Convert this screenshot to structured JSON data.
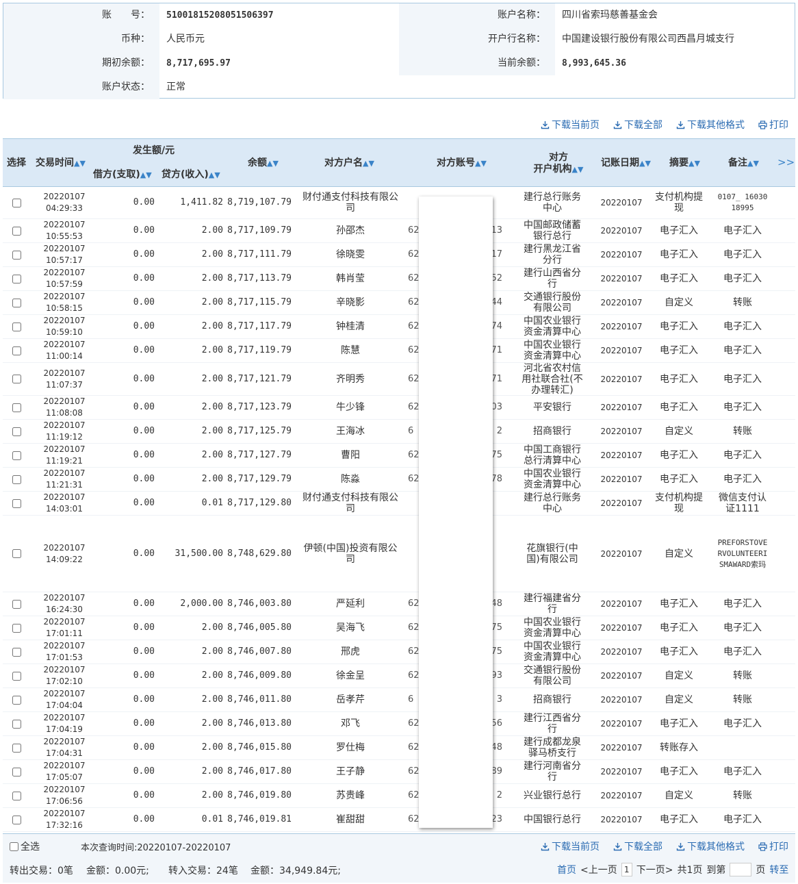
{
  "account_info": {
    "account_no_label": "账　　号：",
    "account_no": "51001815208051506397",
    "account_name_label": "账户名称：",
    "account_name": "四川省索玛慈善基金会",
    "currency_label": "币种：",
    "currency": "人民币元",
    "bank_label": "开户行名称：",
    "bank": "中国建设银行股份有限公司西昌月城支行",
    "opening_balance_label": "期初余额：",
    "opening_balance": "8,717,695.97",
    "current_balance_label": "当前余额：",
    "current_balance": "8,993,645.36",
    "status_label": "账户状态：",
    "status": "正常"
  },
  "toolbar": {
    "download_page": "下载当前页",
    "download_all": "下载全部",
    "download_other": "下载其他格式",
    "print": "打印"
  },
  "table_header": {
    "select": "选择",
    "time": "交易时间",
    "amount_group": "发生额/元",
    "debit": "借方(支取)",
    "credit": "贷方(收入)",
    "balance": "余额",
    "counterparty_name": "对方户名",
    "counterparty_account": "对方账号",
    "counterparty_org_1": "对方",
    "counterparty_org_2": "开户机构",
    "post_date": "记账日期",
    "summary": "摘要",
    "note": "备注",
    "more": ">>"
  },
  "rows": [
    {
      "date": "20220107",
      "time": "04:29:33",
      "debit": "0.00",
      "credit": "1,411.82",
      "balance": "8,719,107.79",
      "name": "财付通支付科技有限公司",
      "acct_pre": "",
      "acct_suf": "",
      "org": "建行总行账务中心",
      "post": "20220107",
      "summary": "支付机构提现",
      "note": "0107_ 16030 18995"
    },
    {
      "date": "20220107",
      "time": "10:55:53",
      "debit": "0.00",
      "credit": "2.00",
      "balance": "8,717,109.79",
      "name": "孙邵杰",
      "acct_pre": "62",
      "acct_suf": "13",
      "org": "中国邮政储蓄银行总行",
      "post": "20220107",
      "summary": "电子汇入",
      "note": "电子汇入"
    },
    {
      "date": "20220107",
      "time": "10:57:17",
      "debit": "0.00",
      "credit": "2.00",
      "balance": "8,717,111.79",
      "name": "徐晓雯",
      "acct_pre": "62",
      "acct_suf": "17",
      "org": "建行黑龙江省分行",
      "post": "20220107",
      "summary": "电子汇入",
      "note": "电子汇入"
    },
    {
      "date": "20220107",
      "time": "10:57:59",
      "debit": "0.00",
      "credit": "2.00",
      "balance": "8,717,113.79",
      "name": "韩肖莹",
      "acct_pre": "62",
      "acct_suf": "52",
      "org": "建行山西省分行",
      "post": "20220107",
      "summary": "电子汇入",
      "note": "电子汇入"
    },
    {
      "date": "20220107",
      "time": "10:58:15",
      "debit": "0.00",
      "credit": "2.00",
      "balance": "8,717,115.79",
      "name": "辛晓影",
      "acct_pre": "62",
      "acct_suf": "44",
      "org": "交通银行股份有限公司",
      "post": "20220107",
      "summary": "自定义",
      "note": "转账"
    },
    {
      "date": "20220107",
      "time": "10:59:10",
      "debit": "0.00",
      "credit": "2.00",
      "balance": "8,717,117.79",
      "name": "钟桂清",
      "acct_pre": "62",
      "acct_suf": "74",
      "org": "中国农业银行资金清算中心",
      "post": "20220107",
      "summary": "电子汇入",
      "note": "电子汇入"
    },
    {
      "date": "20220107",
      "time": "11:00:14",
      "debit": "0.00",
      "credit": "2.00",
      "balance": "8,717,119.79",
      "name": "陈慧",
      "acct_pre": "62",
      "acct_suf": "71",
      "org": "中国农业银行资金清算中心",
      "post": "20220107",
      "summary": "电子汇入",
      "note": "电子汇入"
    },
    {
      "date": "20220107",
      "time": "11:07:37",
      "debit": "0.00",
      "credit": "2.00",
      "balance": "8,717,121.79",
      "name": "齐明秀",
      "acct_pre": "62",
      "acct_suf": "71",
      "org": "河北省农村信用社联合社(不办理转汇)",
      "post": "20220107",
      "summary": "电子汇入",
      "note": "电子汇入"
    },
    {
      "date": "20220107",
      "time": "11:08:08",
      "debit": "0.00",
      "credit": "2.00",
      "balance": "8,717,123.79",
      "name": "牛少锋",
      "acct_pre": "62",
      "acct_suf": "03",
      "org": "平安银行",
      "post": "20220107",
      "summary": "电子汇入",
      "note": "电子汇入"
    },
    {
      "date": "20220107",
      "time": "11:19:12",
      "debit": "0.00",
      "credit": "2.00",
      "balance": "8,717,125.79",
      "name": "王海冰",
      "acct_pre": "6",
      "acct_suf": "2",
      "org": "招商银行",
      "post": "20220107",
      "summary": "自定义",
      "note": "转账"
    },
    {
      "date": "20220107",
      "time": "11:19:21",
      "debit": "0.00",
      "credit": "2.00",
      "balance": "8,717,127.79",
      "name": "曹阳",
      "acct_pre": "62",
      "acct_suf": "75",
      "org": "中国工商银行总行清算中心",
      "post": "20220107",
      "summary": "电子汇入",
      "note": "电子汇入"
    },
    {
      "date": "20220107",
      "time": "11:21:31",
      "debit": "0.00",
      "credit": "2.00",
      "balance": "8,717,129.79",
      "name": "陈淼",
      "acct_pre": "62",
      "acct_suf": "78",
      "org": "中国农业银行资金清算中心",
      "post": "20220107",
      "summary": "电子汇入",
      "note": "电子汇入"
    },
    {
      "date": "20220107",
      "time": "14:03:01",
      "debit": "0.00",
      "credit": "0.01",
      "balance": "8,717,129.80",
      "name": "财付通支付科技有限公司",
      "acct_pre": "",
      "acct_suf": "",
      "org": "建行总行账务中心",
      "post": "20220107",
      "summary": "支付机构提现",
      "note": "微信支付认证1111"
    },
    {
      "date": "20220107",
      "time": "14:09:22",
      "debit": "0.00",
      "credit": "31,500.00",
      "balance": "8,748,629.80",
      "name": "伊顿(中国)投资有限公司",
      "acct_pre": "",
      "acct_suf": "",
      "org": "花旗银行(中国)有限公司",
      "post": "20220107",
      "summary": "自定义",
      "note": "PREFORSTOVERVOLUNTEERISMAWARD索玛"
    },
    {
      "date": "20220107",
      "time": "16:24:30",
      "debit": "0.00",
      "credit": "2,000.00",
      "balance": "8,746,003.80",
      "name": "严延利",
      "acct_pre": "62",
      "acct_suf": "48",
      "org": "建行福建省分行",
      "post": "20220107",
      "summary": "电子汇入",
      "note": "电子汇入"
    },
    {
      "date": "20220107",
      "time": "17:01:11",
      "debit": "0.00",
      "credit": "2.00",
      "balance": "8,746,005.80",
      "name": "吴海飞",
      "acct_pre": "62",
      "acct_suf": "75",
      "org": "中国农业银行资金清算中心",
      "post": "20220107",
      "summary": "电子汇入",
      "note": "电子汇入"
    },
    {
      "date": "20220107",
      "time": "17:01:53",
      "debit": "0.00",
      "credit": "2.00",
      "balance": "8,746,007.80",
      "name": "邢虎",
      "acct_pre": "62",
      "acct_suf": "75",
      "org": "中国农业银行资金清算中心",
      "post": "20220107",
      "summary": "电子汇入",
      "note": "电子汇入"
    },
    {
      "date": "20220107",
      "time": "17:02:10",
      "debit": "0.00",
      "credit": "2.00",
      "balance": "8,746,009.80",
      "name": "徐金呈",
      "acct_pre": "62",
      "acct_suf": "93",
      "org": "交通银行股份有限公司",
      "post": "20220107",
      "summary": "自定义",
      "note": "转账"
    },
    {
      "date": "20220107",
      "time": "17:04:04",
      "debit": "0.00",
      "credit": "2.00",
      "balance": "8,746,011.80",
      "name": "岳孝芹",
      "acct_pre": "6",
      "acct_suf": "3",
      "org": "招商银行",
      "post": "20220107",
      "summary": "自定义",
      "note": "转账"
    },
    {
      "date": "20220107",
      "time": "17:04:19",
      "debit": "0.00",
      "credit": "2.00",
      "balance": "8,746,013.80",
      "name": "邓飞",
      "acct_pre": "62",
      "acct_suf": "56",
      "org": "建行江西省分行",
      "post": "20220107",
      "summary": "电子汇入",
      "note": "电子汇入"
    },
    {
      "date": "20220107",
      "time": "17:04:31",
      "debit": "0.00",
      "credit": "2.00",
      "balance": "8,746,015.80",
      "name": "罗仕梅",
      "acct_pre": "62",
      "acct_suf": "48",
      "org": "建行成都龙泉驿马桥支行",
      "post": "20220107",
      "summary": "转账存入",
      "note": ""
    },
    {
      "date": "20220107",
      "time": "17:05:07",
      "debit": "0.00",
      "credit": "2.00",
      "balance": "8,746,017.80",
      "name": "王子静",
      "acct_pre": "62",
      "acct_suf": "89",
      "org": "建行河南省分行",
      "post": "20220107",
      "summary": "电子汇入",
      "note": "电子汇入"
    },
    {
      "date": "20220107",
      "time": "17:06:56",
      "debit": "0.00",
      "credit": "2.00",
      "balance": "8,746,019.80",
      "name": "苏贵峰",
      "acct_pre": "62",
      "acct_suf": "2",
      "org": "兴业银行总行",
      "post": "20220107",
      "summary": "自定义",
      "note": "转账"
    },
    {
      "date": "20220107",
      "time": "17:32:16",
      "debit": "0.00",
      "credit": "0.01",
      "balance": "8,746,019.81",
      "name": "崔甜甜",
      "acct_pre": "62",
      "acct_suf": "23",
      "org": "中国银行总行",
      "post": "20220107",
      "summary": "电子汇入",
      "note": "电子汇入"
    }
  ],
  "footer": {
    "select_all": "全选",
    "query_time": "本次查询时间:20220107-20220107",
    "out_label": "转出交易：0笔",
    "out_amount": "金额：0.00元;",
    "in_label": "转入交易：24笔",
    "in_amount": "金额：34,949.84元;",
    "first": "首页",
    "prev": "<上一页",
    "page": "1",
    "next": "下一页>",
    "total": "共1页",
    "goto_pre": "到第",
    "goto_post": "页",
    "goto": "转至"
  },
  "colors": {
    "accent": "#2a6bb2",
    "header_bg": "#dbe9f6",
    "border": "#a8c8e0",
    "label_bg": "#f2f6fa"
  }
}
